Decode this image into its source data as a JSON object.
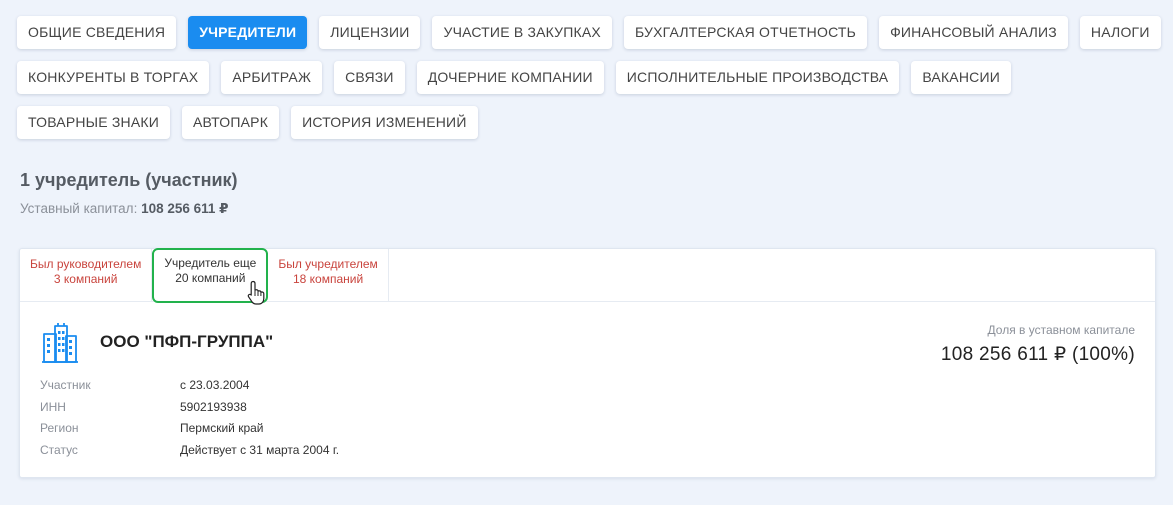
{
  "nav": {
    "tabs": [
      {
        "label": "ОБЩИЕ СВЕДЕНИЯ"
      },
      {
        "label": "УЧРЕДИТЕЛИ"
      },
      {
        "label": "ЛИЦЕНЗИИ"
      },
      {
        "label": "УЧАСТИЕ В ЗАКУПКАХ"
      },
      {
        "label": "БУХГАЛТЕРСКАЯ ОТЧЕТНОСТЬ"
      },
      {
        "label": "ФИНАНСОВЫЙ АНАЛИЗ"
      },
      {
        "label": "НАЛОГИ"
      },
      {
        "label": "КОНКУРЕНТЫ В ТОРГАХ"
      },
      {
        "label": "АРБИТРАЖ"
      },
      {
        "label": "СВЯЗИ"
      },
      {
        "label": "ДОЧЕРНИЕ КОМПАНИИ"
      },
      {
        "label": "ИСПОЛНИТЕЛЬНЫЕ ПРОИЗВОДСТВА"
      },
      {
        "label": "ВАКАНСИИ"
      },
      {
        "label": "ТОВАРНЫЕ ЗНАКИ"
      },
      {
        "label": "АВТОПАРК"
      },
      {
        "label": "ИСТОРИЯ ИЗМЕНЕНИЙ"
      }
    ],
    "active": "УЧРЕДИТЕЛИ"
  },
  "section": {
    "title": "1 учредитель (участник)",
    "capital_label": "Уставный капитал:",
    "capital_value": "108 256 611 ₽"
  },
  "card": {
    "subtabs": [
      {
        "line1": "Был руководителем",
        "line2": "3 компаний"
      },
      {
        "line1": "Учредитель еще",
        "line2": "20 компаний"
      },
      {
        "line1": "Был учредителем",
        "line2": "18 компаний"
      }
    ],
    "company_name": "ООО \"ПФП-ГРУППА\"",
    "share_label": "Доля в уставном капитале",
    "share_value": "108 256 611 ₽ (100%)",
    "details": [
      {
        "key": "Участник",
        "value": "с 23.03.2004"
      },
      {
        "key": "ИНН",
        "value": "5902193938"
      },
      {
        "key": "Регион",
        "value": "Пермский край"
      },
      {
        "key": "Статус",
        "value": "Действует с 31 марта 2004 г."
      }
    ]
  },
  "colors": {
    "accent": "#1a8cf0",
    "link_red": "#c9443d",
    "highlight_green": "#22b24c",
    "icon_blue": "#1a8cf0"
  },
  "icons": {
    "company": "building-icon",
    "cursor": "hand-pointer-icon"
  }
}
